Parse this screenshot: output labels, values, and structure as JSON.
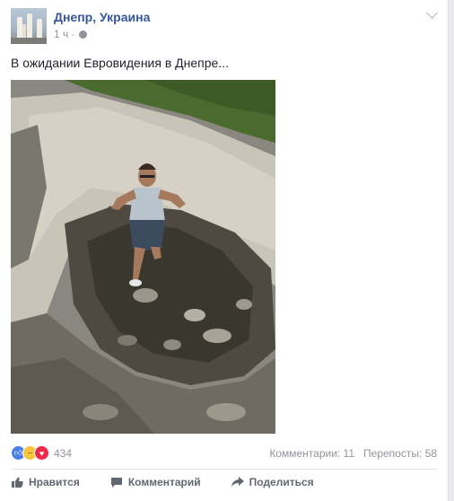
{
  "post": {
    "page_name": "Днепр, Украина",
    "time": "1 ч",
    "separator": "·",
    "privacy_icon": "globe-icon",
    "menu_icon": "chevron-down-icon",
    "text": "В ожидании Евровидения в Днепре...",
    "photo_description_icon": "photo"
  },
  "reactions": {
    "icons": [
      "like-reaction-icon",
      "haha-reaction-icon",
      "love-reaction-icon"
    ],
    "count": "434"
  },
  "stats": {
    "comments": "Комментарии: 11",
    "shares": "Перепосты: 58"
  },
  "actions": {
    "like": "Нравится",
    "comment": "Комментарий",
    "share": "Поделиться"
  },
  "colors": {
    "link": "#365899",
    "meta": "#90949c",
    "like_blue": "#4b7ee8",
    "love_red": "#f0284a",
    "haha_yellow": "#f7c63d"
  }
}
